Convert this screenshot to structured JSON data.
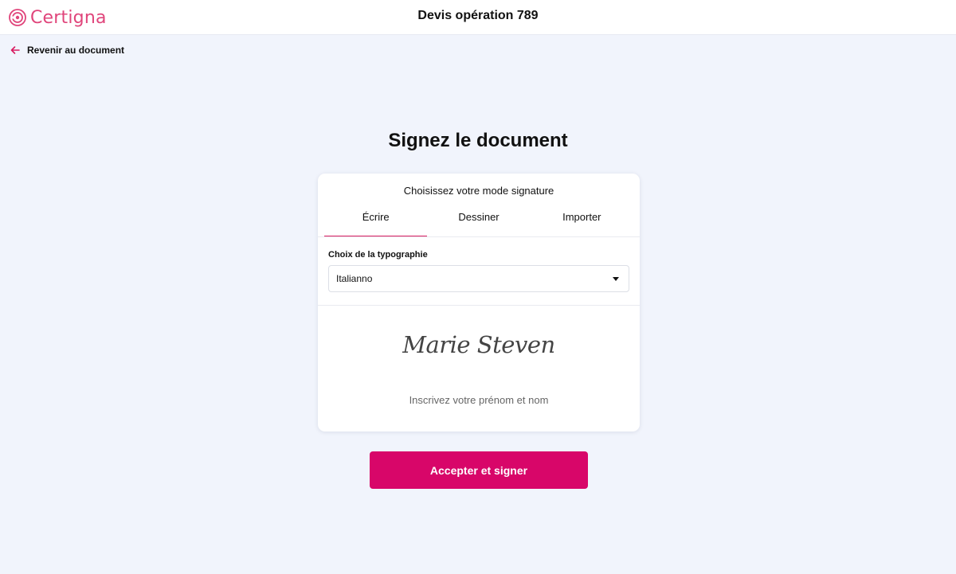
{
  "header": {
    "logo_text": "Certigna",
    "document_title": "Devis opération 789",
    "brand_color": "#e0457b"
  },
  "navigation": {
    "back_label": "Revenir au document",
    "back_icon": "arrow-left-icon"
  },
  "main": {
    "heading": "Signez le document"
  },
  "signature_card": {
    "subtitle": "Choisissez votre mode signature",
    "tabs": [
      {
        "label": "Écrire",
        "active": true
      },
      {
        "label": "Dessiner",
        "active": false
      },
      {
        "label": "Importer",
        "active": false
      }
    ],
    "typography": {
      "label": "Choix de la typographie",
      "selected": "Italianno"
    },
    "preview_text": "Marie Steven",
    "hint": "Inscrivez votre prénom et nom"
  },
  "actions": {
    "sign_label": "Accepter et signer",
    "accent_color": "#d80669"
  }
}
